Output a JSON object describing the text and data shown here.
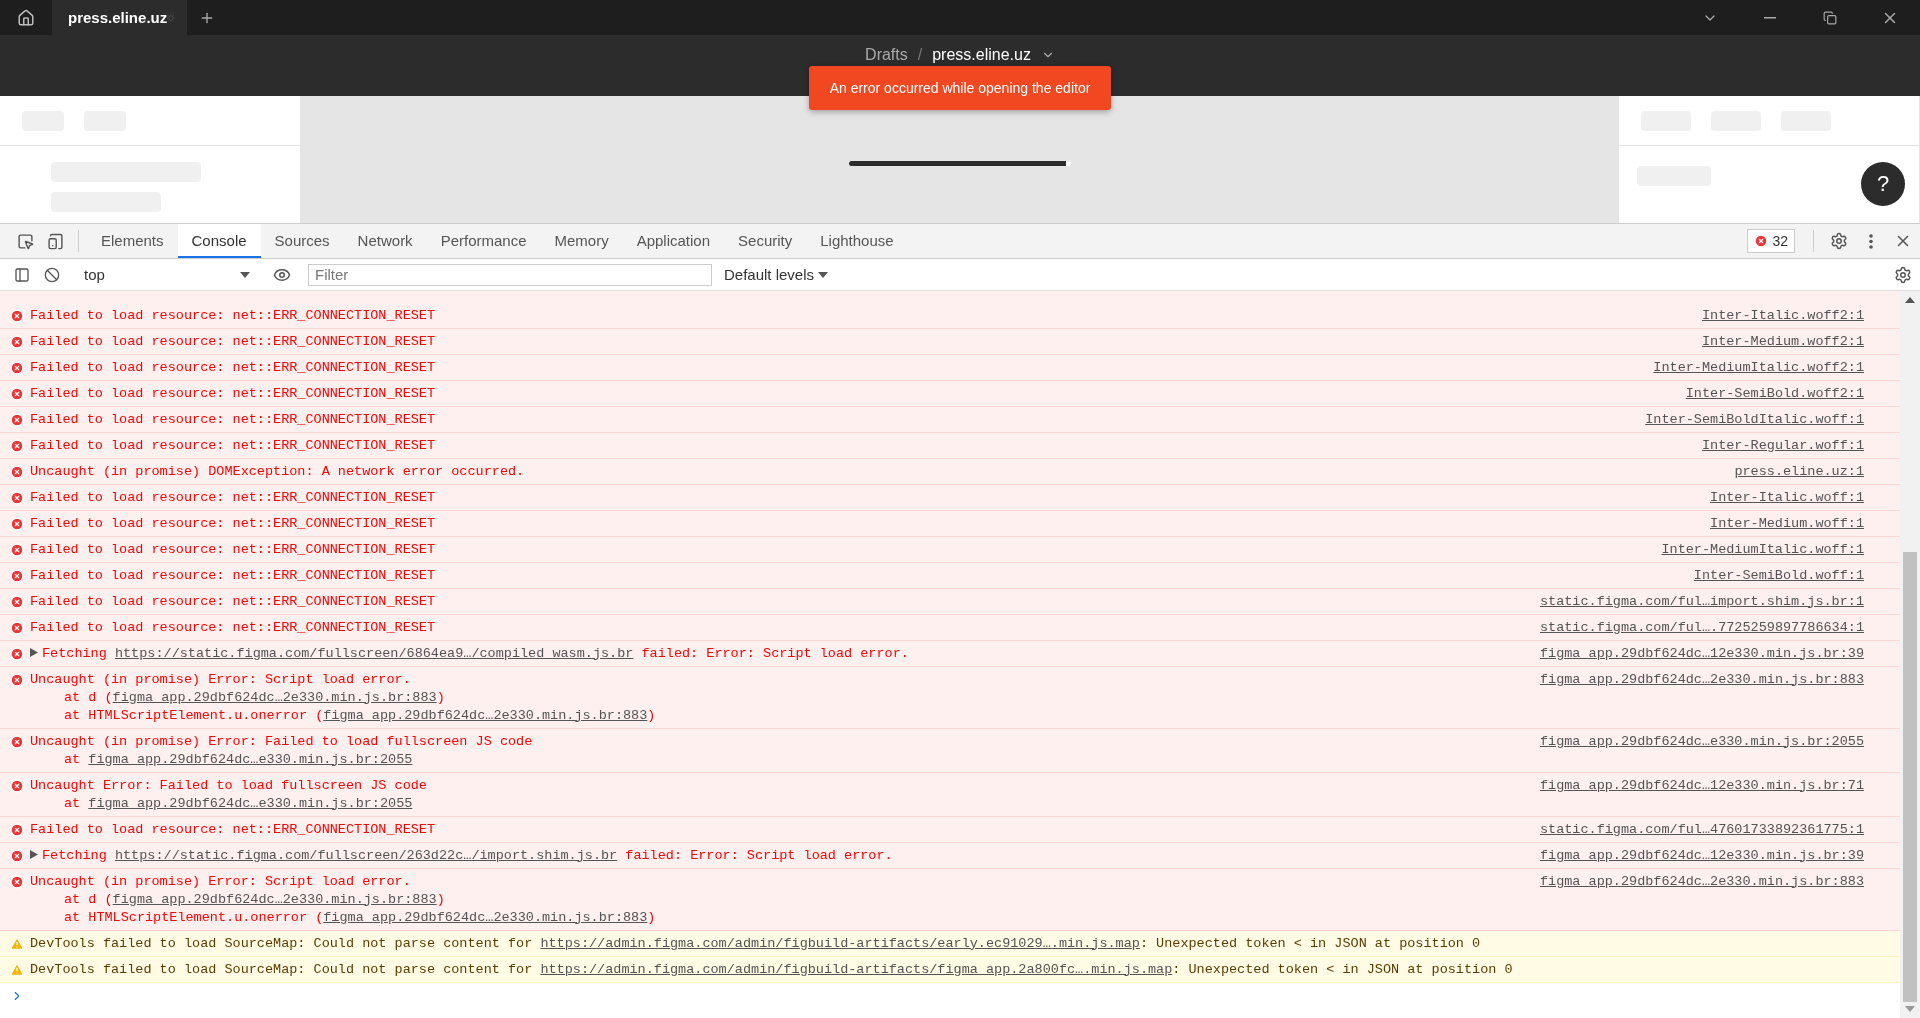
{
  "browser": {
    "tabs": [
      {
        "title": "press.eline.uz",
        "selected": true,
        "loading": true
      }
    ]
  },
  "app_header": {
    "breadcrumb": [
      "Drafts",
      "press.eline.uz"
    ],
    "separator": "/"
  },
  "toast": {
    "message": "An error occurred while opening the editor"
  },
  "loader": {
    "level": 0.98
  },
  "help": {
    "label": "?"
  },
  "devtools": {
    "tabs": [
      {
        "label": "Elements",
        "selected": false
      },
      {
        "label": "Console",
        "selected": true
      },
      {
        "label": "Sources",
        "selected": false
      },
      {
        "label": "Network",
        "selected": false
      },
      {
        "label": "Performance",
        "selected": false
      },
      {
        "label": "Memory",
        "selected": false
      },
      {
        "label": "Application",
        "selected": false
      },
      {
        "label": "Security",
        "selected": false
      },
      {
        "label": "Lighthouse",
        "selected": false
      }
    ],
    "error_count": "32",
    "context": "top",
    "filter": {
      "placeholder": "Filter"
    },
    "levels": "Default levels",
    "messages": [
      {
        "kind": "error",
        "lines": [
          {
            "pre": "Failed to load resource: net::ERR_CONNECTION_RESET"
          }
        ],
        "source": "Inter-Italic.woff2:1"
      },
      {
        "kind": "error",
        "lines": [
          {
            "pre": "Failed to load resource: net::ERR_CONNECTION_RESET"
          }
        ],
        "source": "Inter-Medium.woff2:1"
      },
      {
        "kind": "error",
        "lines": [
          {
            "pre": "Failed to load resource: net::ERR_CONNECTION_RESET"
          }
        ],
        "source": "Inter-MediumItalic.woff2:1"
      },
      {
        "kind": "error",
        "lines": [
          {
            "pre": "Failed to load resource: net::ERR_CONNECTION_RESET"
          }
        ],
        "source": "Inter-SemiBold.woff2:1"
      },
      {
        "kind": "error",
        "lines": [
          {
            "pre": "Failed to load resource: net::ERR_CONNECTION_RESET"
          }
        ],
        "source": "Inter-SemiBoldItalic.woff:1"
      },
      {
        "kind": "error",
        "lines": [
          {
            "pre": "Failed to load resource: net::ERR_CONNECTION_RESET"
          }
        ],
        "source": "Inter-Regular.woff:1"
      },
      {
        "kind": "error",
        "lines": [
          {
            "pre": "Uncaught (in promise) DOMException: A network error occurred."
          }
        ],
        "source": "press.eline.uz:1"
      },
      {
        "kind": "error",
        "lines": [
          {
            "pre": "Failed to load resource: net::ERR_CONNECTION_RESET"
          }
        ],
        "source": "Inter-Italic.woff:1"
      },
      {
        "kind": "error",
        "lines": [
          {
            "pre": "Failed to load resource: net::ERR_CONNECTION_RESET"
          }
        ],
        "source": "Inter-Medium.woff:1"
      },
      {
        "kind": "error",
        "lines": [
          {
            "pre": "Failed to load resource: net::ERR_CONNECTION_RESET"
          }
        ],
        "source": "Inter-MediumItalic.woff:1"
      },
      {
        "kind": "error",
        "lines": [
          {
            "pre": "Failed to load resource: net::ERR_CONNECTION_RESET"
          }
        ],
        "source": "Inter-SemiBold.woff:1"
      },
      {
        "kind": "error",
        "lines": [
          {
            "pre": "Failed to load resource: net::ERR_CONNECTION_RESET"
          }
        ],
        "source": "static.figma.com/ful…import.shim.js.br:1"
      },
      {
        "kind": "error",
        "lines": [
          {
            "pre": "Failed to load resource: net::ERR_CONNECTION_RESET"
          }
        ],
        "source": "static.figma.com/ful….7725259897786634:1"
      },
      {
        "kind": "error",
        "expandable": true,
        "lines": [
          {
            "pre": "Fetching ",
            "link": "https://static.figma.com/fullscreen/6864ea9…/compiled_wasm.js.br",
            "post": " failed: Error: Script load error."
          }
        ],
        "source": "figma_app.29dbf624dc…12e330.min.js.br:39"
      },
      {
        "kind": "error",
        "lines": [
          {
            "pre": "Uncaught (in promise) Error: Script load error."
          },
          {
            "pre": "at d (",
            "link": "figma_app.29dbf624dc…2e330.min.js.br:883",
            "post": ")"
          },
          {
            "pre": "at HTMLScriptElement.u.onerror (",
            "link": "figma_app.29dbf624dc…2e330.min.js.br:883",
            "post": ")"
          }
        ],
        "source": "figma_app.29dbf624dc…2e330.min.js.br:883"
      },
      {
        "kind": "error",
        "lines": [
          {
            "pre": "Uncaught (in promise) Error: Failed to load fullscreen JS code"
          },
          {
            "pre": "at ",
            "link": "figma_app.29dbf624dc…e330.min.js.br:2055"
          }
        ],
        "source": "figma_app.29dbf624dc…e330.min.js.br:2055"
      },
      {
        "kind": "error",
        "lines": [
          {
            "pre": "Uncaught Error: Failed to load fullscreen JS code"
          },
          {
            "pre": "at ",
            "link": "figma_app.29dbf624dc…e330.min.js.br:2055"
          }
        ],
        "source": "figma_app.29dbf624dc…12e330.min.js.br:71"
      },
      {
        "kind": "error",
        "lines": [
          {
            "pre": "Failed to load resource: net::ERR_CONNECTION_RESET"
          }
        ],
        "source": "static.figma.com/ful…47601733892361775:1"
      },
      {
        "kind": "error",
        "expandable": true,
        "lines": [
          {
            "pre": "Fetching ",
            "link": "https://static.figma.com/fullscreen/263d22c…/import.shim.js.br",
            "post": " failed: Error: Script load error."
          }
        ],
        "source": "figma_app.29dbf624dc…12e330.min.js.br:39"
      },
      {
        "kind": "error",
        "lines": [
          {
            "pre": "Uncaught (in promise) Error: Script load error."
          },
          {
            "pre": "at d (",
            "link": "figma_app.29dbf624dc…2e330.min.js.br:883",
            "post": ")"
          },
          {
            "pre": "at HTMLScriptElement.u.onerror (",
            "link": "figma_app.29dbf624dc…2e330.min.js.br:883",
            "post": ")"
          }
        ],
        "source": "figma_app.29dbf624dc…2e330.min.js.br:883"
      },
      {
        "kind": "warning",
        "lines": [
          {
            "pre": "DevTools failed to load SourceMap: Could not parse content for ",
            "link": "https://admin.figma.com/admin/figbuild-artifacts/early.ec91029….min.js.map",
            "post": ": Unexpected token < in JSON at position 0"
          }
        ]
      },
      {
        "kind": "warning",
        "lines": [
          {
            "pre": "DevTools failed to load SourceMap: Could not parse content for ",
            "link": "https://admin.figma.com/admin/figbuild-artifacts/figma_app.2a800fc….min.js.map",
            "post": ": Unexpected token < in JSON at position 0"
          }
        ]
      }
    ]
  }
}
